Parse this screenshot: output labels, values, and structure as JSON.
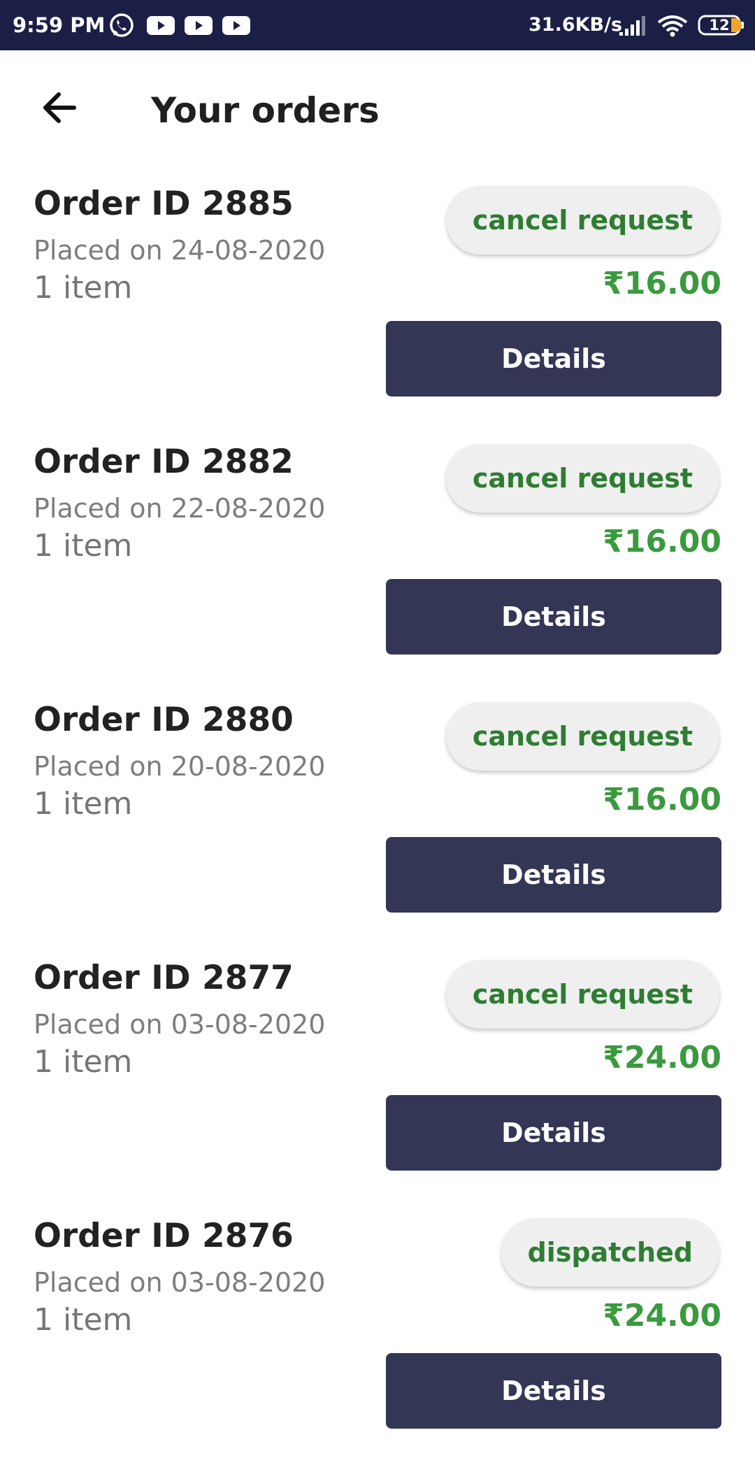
{
  "status_bar": {
    "time": "9:59 PM",
    "network_speed": "31.6KB/s",
    "battery_level": "12",
    "notification_icons": [
      "whatsapp-icon",
      "youtube-icon",
      "youtube-icon",
      "youtube-icon"
    ],
    "system_icons": [
      "signal-icon",
      "wifi-icon",
      "battery-icon"
    ]
  },
  "header": {
    "back_icon": "arrow-left-icon",
    "title": "Your orders"
  },
  "colors": {
    "status_bar_bg": "#1b1f45",
    "button_bg": "#333655",
    "status_text": "#2e7d32",
    "price_text": "#3a9a3e",
    "chip_bg": "#efefef"
  },
  "orders": [
    {
      "id": "Order ID 2885",
      "placed_on": "Placed on 24-08-2020",
      "items": "1 item",
      "status": "cancel request",
      "price": "₹16.00",
      "details_label": "Details"
    },
    {
      "id": "Order ID 2882",
      "placed_on": "Placed on 22-08-2020",
      "items": "1 item",
      "status": "cancel request",
      "price": "₹16.00",
      "details_label": "Details"
    },
    {
      "id": "Order ID 2880",
      "placed_on": "Placed on 20-08-2020",
      "items": "1 item",
      "status": "cancel request",
      "price": "₹16.00",
      "details_label": "Details"
    },
    {
      "id": "Order ID 2877",
      "placed_on": "Placed on 03-08-2020",
      "items": "1 item",
      "status": "cancel request",
      "price": "₹24.00",
      "details_label": "Details"
    },
    {
      "id": "Order ID 2876",
      "placed_on": "Placed on 03-08-2020",
      "items": "1 item",
      "status": "dispatched",
      "price": "₹24.00",
      "details_label": "Details"
    }
  ]
}
